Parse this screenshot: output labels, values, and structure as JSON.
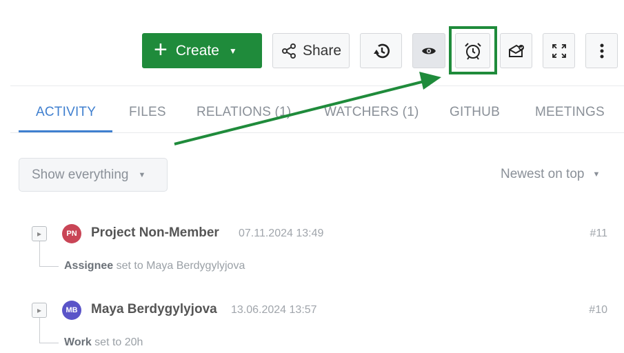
{
  "toolbar": {
    "create_label": "Create",
    "share_label": "Share"
  },
  "tabs": [
    {
      "label": "ACTIVITY",
      "active": true
    },
    {
      "label": "FILES",
      "active": false
    },
    {
      "label": "RELATIONS (1)",
      "active": false
    },
    {
      "label": "WATCHERS (1)",
      "active": false
    },
    {
      "label": "GITHUB",
      "active": false
    },
    {
      "label": "MEETINGS",
      "active": false
    }
  ],
  "filters": {
    "show_label": "Show everything",
    "sort_label": "Newest on top"
  },
  "activity": [
    {
      "initials": "PN",
      "avatar_color": "#c94556",
      "author": "Project Non-Member",
      "timestamp": "07.11.2024 13:49",
      "number": "#11",
      "detail_field": "Assignee",
      "detail_text": "set to Maya Berdygylyjova"
    },
    {
      "initials": "MB",
      "avatar_color": "#5a54c8",
      "author": "Maya Berdygylyjova",
      "timestamp": "13.06.2024 13:57",
      "number": "#10",
      "detail_field": "Work",
      "detail_text": "set to 20h"
    }
  ],
  "colors": {
    "primary_green": "#1f8b3b",
    "active_tab_blue": "#3f7fcf",
    "highlight_green": "#1f8b3b"
  },
  "icons": [
    "plus-icon",
    "chevron-down-icon",
    "share-icon",
    "history-icon",
    "eye-icon",
    "alarm-clock-icon",
    "mail-badge-icon",
    "fullscreen-icon",
    "more-vertical-icon",
    "expand-toggle-icon"
  ]
}
